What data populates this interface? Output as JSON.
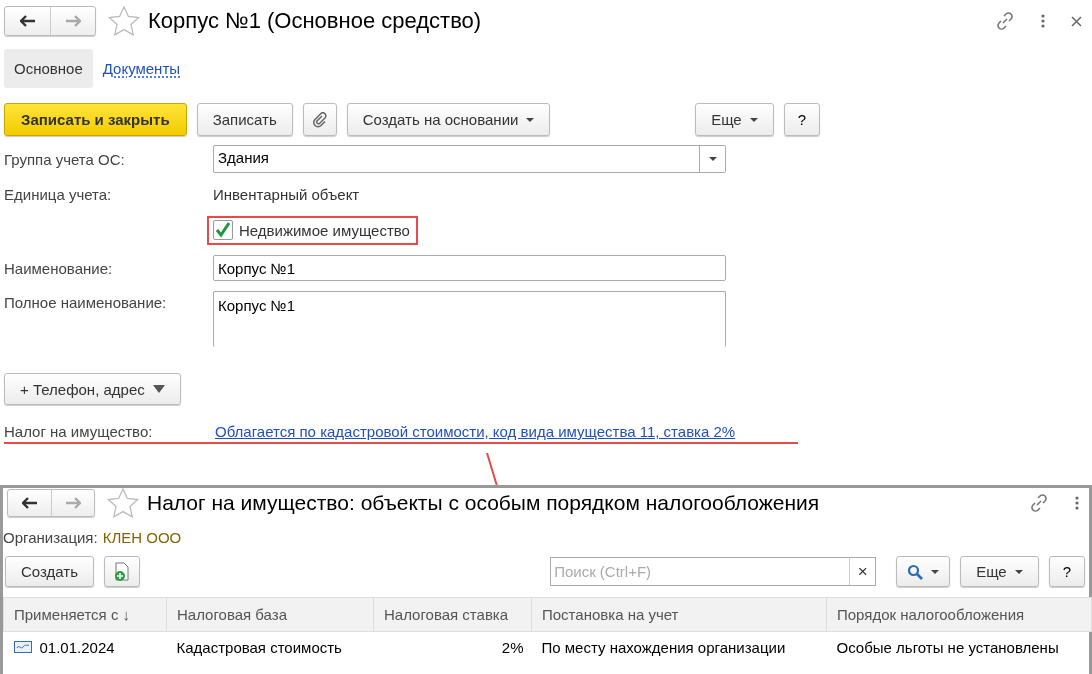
{
  "window": {
    "title": "Корпус №1 (Основное средство)"
  },
  "tabs": [
    {
      "label": "Основное",
      "selected": true
    },
    {
      "label": "Документы",
      "selected": false
    }
  ],
  "toolbar": {
    "save_close": "Записать и закрыть",
    "save": "Записать",
    "create_based": "Создать на основании",
    "more": "Еще",
    "help": "?"
  },
  "fields": [
    {
      "kind": "select",
      "label": "Группа учета ОС:",
      "value": "Здания"
    },
    {
      "kind": "text",
      "label": "Единица учета:",
      "value": "Инвентарный объект"
    },
    {
      "kind": "checkbox",
      "value": "Недвижимое имущество",
      "checked": true
    },
    {
      "kind": "input",
      "label": "Наименование:",
      "value": "Корпус №1"
    },
    {
      "kind": "textarea",
      "label": "Полное наименование:",
      "value": "Корпус №1"
    }
  ],
  "contact_button": "+ Телефон, адрес",
  "tax": {
    "label": "Налог на имущество:",
    "link": "Облагается по кадастровой стоимости, код вида имущества 11, ставка 2%"
  },
  "sub_window": {
    "title": "Налог на имущество: объекты с особым порядком налогообложения",
    "org_label": "Организация:",
    "org_value": "КЛЕН ООО",
    "create": "Создать",
    "search_placeholder": "Поиск (Ctrl+F)",
    "search_clear": "×",
    "more": "Еще",
    "help": "?",
    "columns": [
      {
        "label": "Применяется с",
        "sort": "↓"
      },
      {
        "label": "Налоговая база"
      },
      {
        "label": "Налоговая ставка"
      },
      {
        "label": "Постановка на учет"
      },
      {
        "label": "Порядок налогообложения"
      }
    ],
    "rows": [
      {
        "cells": [
          "01.01.2024",
          "Кадастровая стоимость",
          "2%",
          "По месту нахождения организации",
          "Особые льготы не установлены"
        ]
      }
    ]
  }
}
